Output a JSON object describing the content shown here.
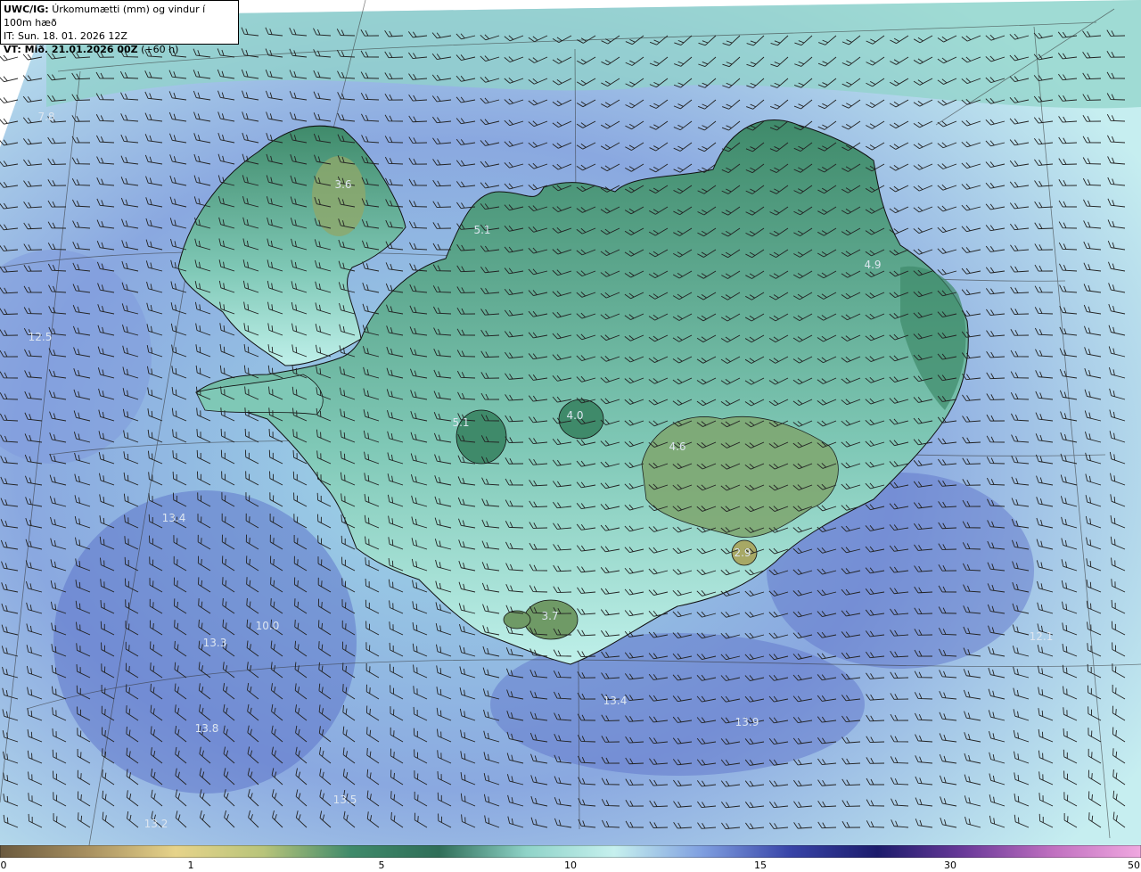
{
  "header": {
    "model": "UWC/IG:",
    "title": "Úrkomumætti (mm) og vindur í 100m hæð",
    "it_line": "IT: Sun. 18. 01. 2026 12Z",
    "vt_label": "VT: Mið. 21.01.2026 00Z",
    "vt_offset": "(+60 h)"
  },
  "map_labels": [
    "7.8",
    "3.6",
    "5.1",
    "4.9",
    "12.5",
    "4.0",
    "5.1",
    "4.6",
    "13.4",
    "2.9",
    "3.7",
    "13.3",
    "10.0",
    "13.4",
    "13.9",
    "13.8",
    "13.5",
    "13.2",
    "12.1"
  ],
  "colorbar": {
    "ticks": [
      "0",
      "1",
      "5",
      "10",
      "15",
      "30",
      "50"
    ],
    "colors": [
      "#6b5a3e",
      "#a89060",
      "#e6d38a",
      "#b8c47a",
      "#3f8a6a",
      "#2f6e58",
      "#8fd3c8",
      "#c6f0ee",
      "#7f9fe0",
      "#3844a8",
      "#1c1c6c",
      "#6b3a9a",
      "#c070c0",
      "#f0a8e0"
    ]
  },
  "colors": {
    "ocean": "#7b8fd8",
    "land_low": "#8fd9cc",
    "land_high": "#2f7a5e",
    "peak": "#a7a865"
  },
  "icons": [
    "wind-barb-icon"
  ]
}
